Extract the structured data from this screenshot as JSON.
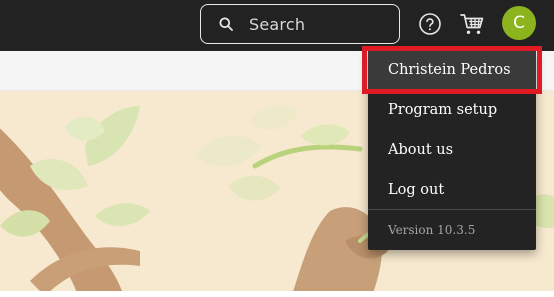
{
  "header": {
    "search": {
      "placeholder": "Search"
    },
    "help_icon": "question-circle-icon",
    "cart_icon": "shopping-cart-icon",
    "avatar": {
      "initial": "C",
      "color": "#8bb41f"
    }
  },
  "user_menu": {
    "items": [
      {
        "label": "Christein Pedros",
        "active": true
      },
      {
        "label": "Program setup"
      },
      {
        "label": "About us"
      },
      {
        "label": "Log out"
      }
    ],
    "version": "Version 10.3.5"
  },
  "highlight_color": "#e01b24",
  "hero_background": "#f7e9cf"
}
